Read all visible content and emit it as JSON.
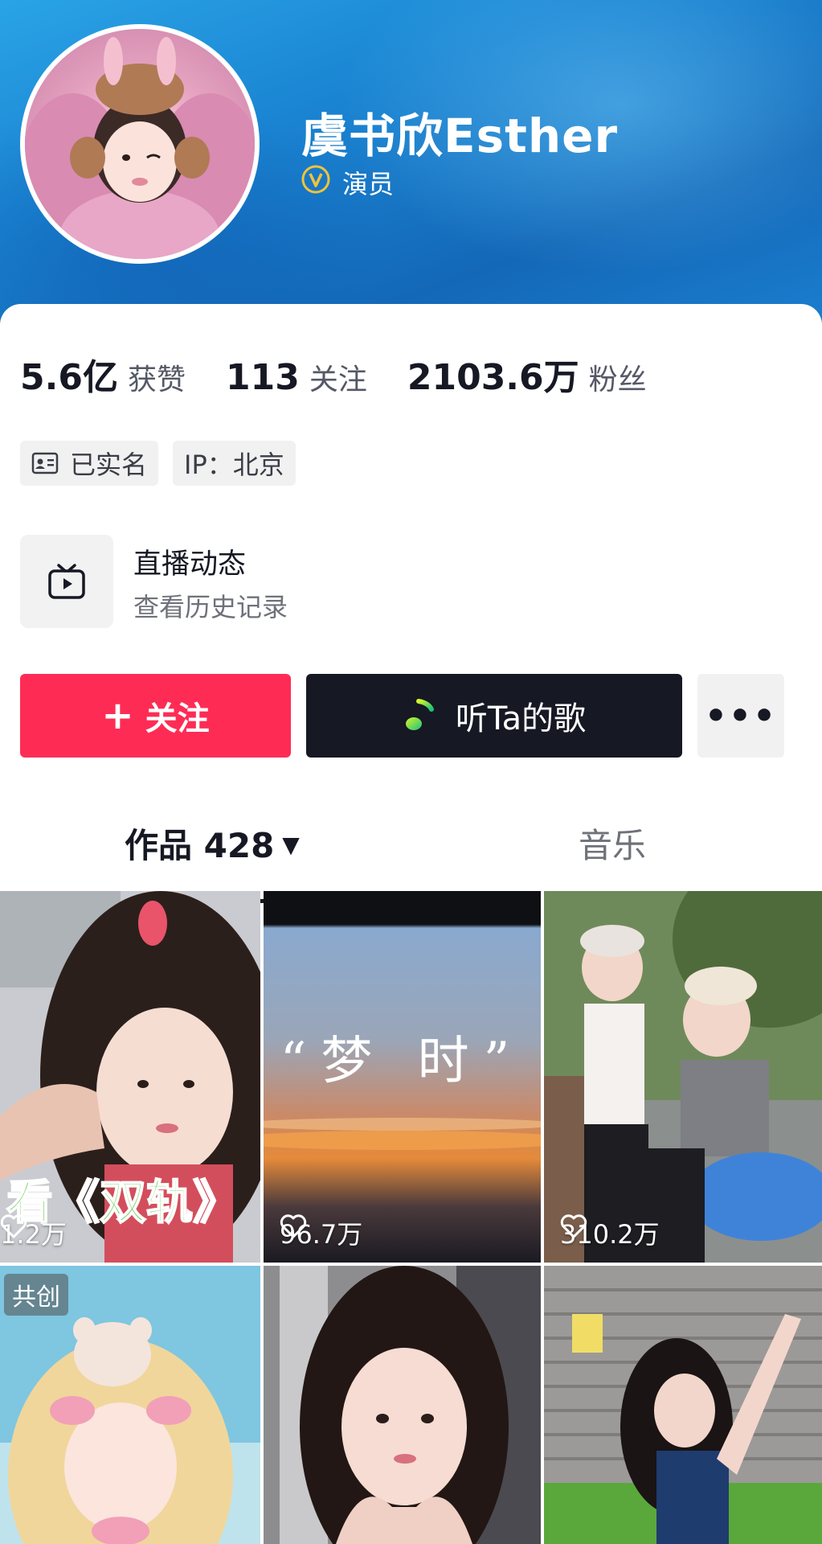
{
  "profile": {
    "name": "虞书欣Esther",
    "role": "演员",
    "verify_icon": "verified-v-icon"
  },
  "stats": [
    {
      "value": "5.6亿",
      "label": "获赞"
    },
    {
      "value": "113",
      "label": "关注"
    },
    {
      "value": "2103.6万",
      "label": "粉丝"
    }
  ],
  "tags": {
    "verified": "已实名",
    "ip": "IP：北京"
  },
  "live": {
    "title": "直播动态",
    "subtitle": "查看历史记录",
    "icon": "tv-play-icon"
  },
  "buttons": {
    "follow_plus": "+",
    "follow": "关注",
    "music": "听Ta的歌",
    "more": "•••"
  },
  "tabs": {
    "works": "作品 428",
    "works_caret": "▼",
    "music": "音乐"
  },
  "videos": [
    {
      "likes": "1.2万",
      "overlay": "看《双轨》"
    },
    {
      "likes": "96.7万",
      "overlay": "“梦 时”"
    },
    {
      "likes": "310.2万"
    },
    {
      "badge": "共创"
    },
    {},
    {}
  ],
  "colors": {
    "header_blue": "#1a84d2",
    "follow_red": "#fe2c55",
    "music_dark": "#161823"
  }
}
